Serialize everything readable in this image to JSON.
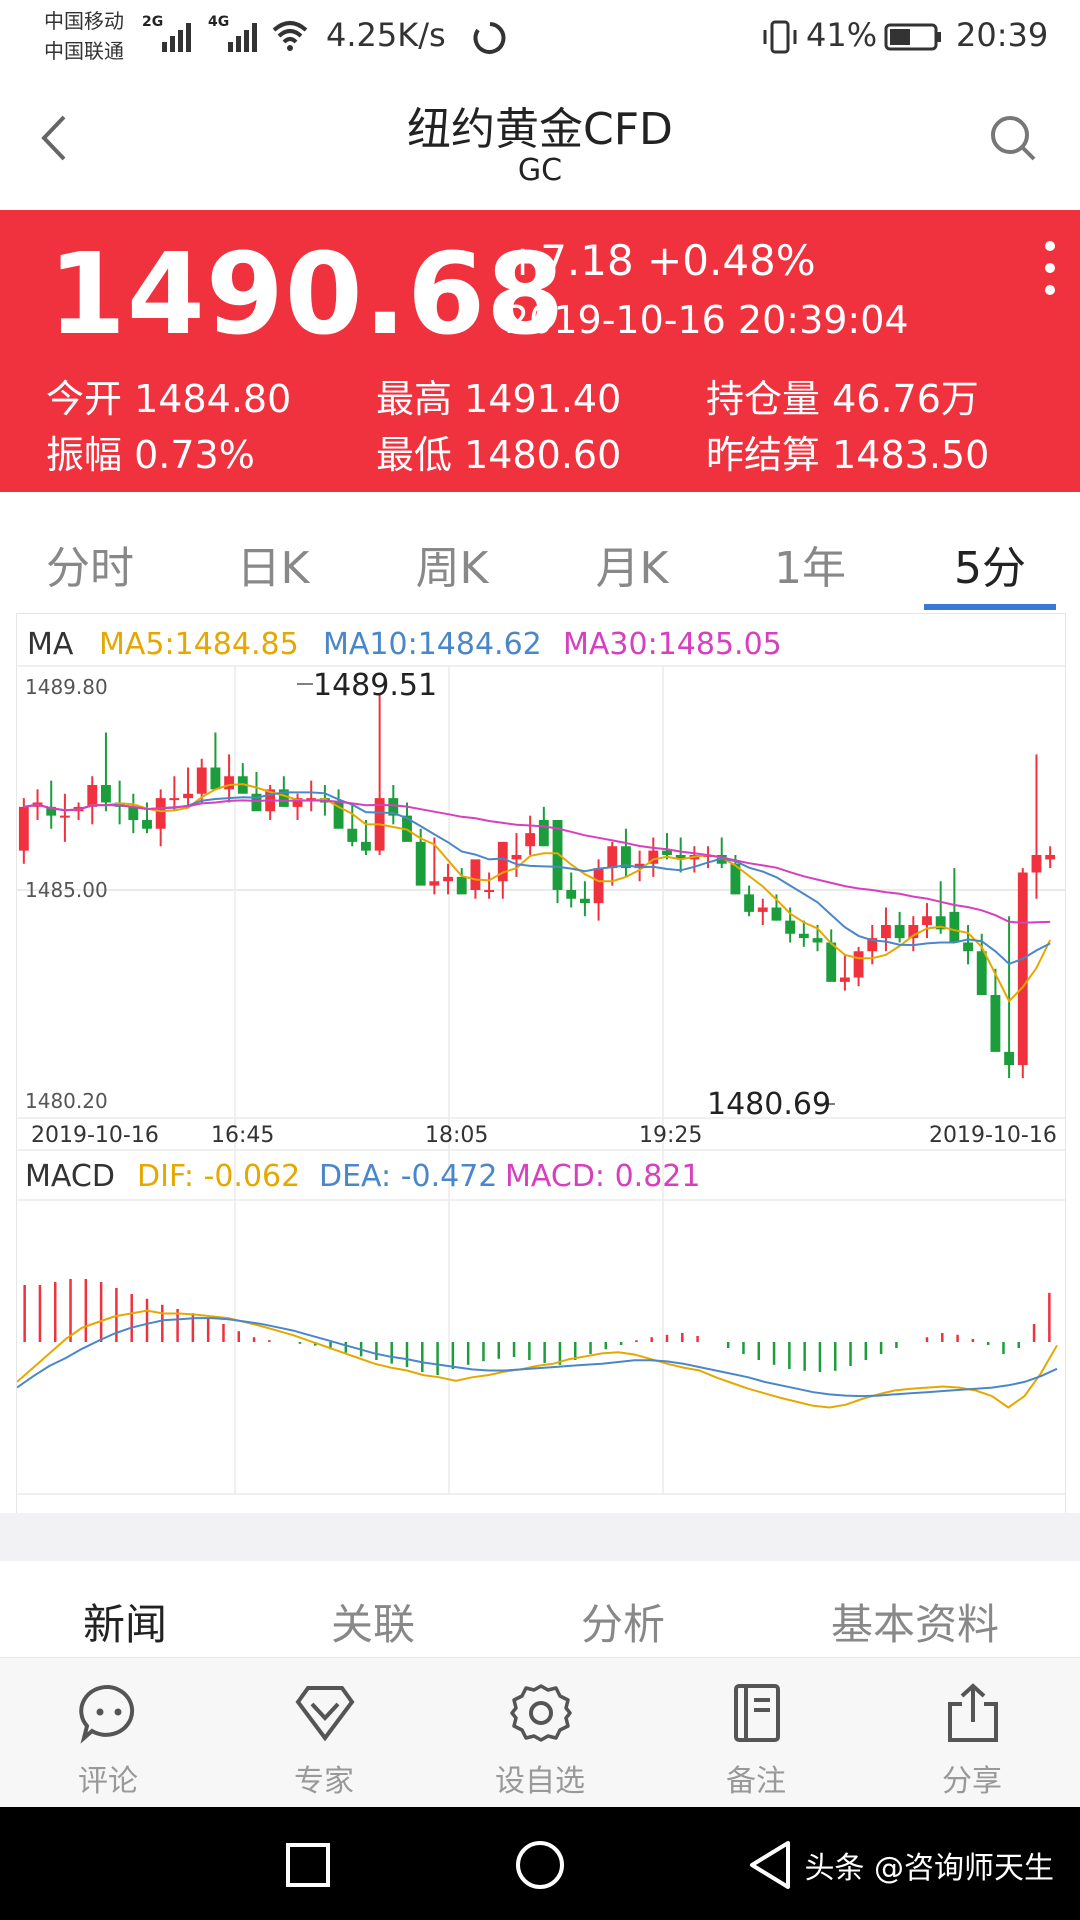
{
  "status_bar": {
    "carrier1": "中国移动",
    "carrier2": "中国联通",
    "net1": "2G",
    "net2": "4G",
    "speed": "4.25K/s",
    "battery": "41%",
    "time": "20:39"
  },
  "header": {
    "title": "纽约黄金CFD",
    "subtitle": "GC"
  },
  "quote": {
    "price": "1490.68",
    "change": "+7.18 +0.48%",
    "datetime": "2019-10-16 20:39:04",
    "stats": [
      {
        "label": "今开",
        "value": "1484.80"
      },
      {
        "label": "最高",
        "value": "1491.40"
      },
      {
        "label": "持仓量",
        "value": "46.76万"
      },
      {
        "label": "振幅",
        "value": "0.73%"
      },
      {
        "label": "最低",
        "value": "1480.60"
      },
      {
        "label": "昨结算",
        "value": "1483.50"
      }
    ]
  },
  "tabs": [
    "分时",
    "日K",
    "周K",
    "月K",
    "1年",
    "5分"
  ],
  "active_tab": "5分",
  "colors": {
    "up": "#f0313e",
    "down": "#1a9d3a",
    "ma5": "#e6a800",
    "ma10": "#4a87c9",
    "ma30": "#d83fbf",
    "accent": "#3a79d3"
  },
  "chart_data": [
    {
      "type": "candlestick",
      "legend": {
        "ma": "MA",
        "ma5": "MA5:1484.85",
        "ma10": "MA10:1484.62",
        "ma30": "MA30:1485.05"
      },
      "ylim": [
        1480.2,
        1489.8
      ],
      "y_ticks": [
        "1489.80",
        "1485.00",
        "1480.20"
      ],
      "x_ticks": [
        "2019-10-16",
        "16:45",
        "18:05",
        "19:25",
        "2019-10-16"
      ],
      "annotations": {
        "high": "1489.51",
        "low": "1480.69"
      },
      "ohlc": [
        [
          1485.9,
          1487.1,
          1485.6,
          1486.9
        ],
        [
          1486.9,
          1487.3,
          1486.6,
          1487.0
        ],
        [
          1486.9,
          1487.5,
          1486.4,
          1486.7
        ],
        [
          1486.7,
          1487.2,
          1486.1,
          1486.7
        ],
        [
          1486.8,
          1487.0,
          1486.6,
          1486.9
        ],
        [
          1486.9,
          1487.6,
          1486.5,
          1487.4
        ],
        [
          1487.4,
          1488.6,
          1486.8,
          1487.0
        ],
        [
          1487.0,
          1487.5,
          1486.5,
          1486.9
        ],
        [
          1486.9,
          1487.2,
          1486.3,
          1486.6
        ],
        [
          1486.6,
          1487.0,
          1486.3,
          1486.4
        ],
        [
          1486.4,
          1487.3,
          1486.0,
          1487.1
        ],
        [
          1487.1,
          1487.6,
          1486.8,
          1487.1
        ],
        [
          1487.1,
          1487.8,
          1486.9,
          1487.2
        ],
        [
          1487.2,
          1488.0,
          1487.0,
          1487.8
        ],
        [
          1487.8,
          1488.6,
          1487.4,
          1487.3
        ],
        [
          1487.3,
          1488.1,
          1487.0,
          1487.6
        ],
        [
          1487.6,
          1487.9,
          1487.3,
          1487.2
        ],
        [
          1487.2,
          1487.7,
          1486.9,
          1486.8
        ],
        [
          1486.8,
          1487.4,
          1486.6,
          1487.3
        ],
        [
          1487.3,
          1487.6,
          1486.9,
          1486.9
        ],
        [
          1486.9,
          1487.2,
          1486.6,
          1487.1
        ],
        [
          1487.1,
          1487.5,
          1486.8,
          1487.1
        ],
        [
          1487.1,
          1487.4,
          1486.7,
          1487.0
        ],
        [
          1487.0,
          1487.3,
          1486.5,
          1486.4
        ],
        [
          1486.4,
          1487.0,
          1486.0,
          1486.1
        ],
        [
          1486.1,
          1486.6,
          1485.8,
          1485.9
        ],
        [
          1485.9,
          1489.5,
          1485.8,
          1487.1
        ],
        [
          1487.1,
          1487.4,
          1486.5,
          1486.7
        ],
        [
          1486.7,
          1487.0,
          1486.3,
          1486.1
        ],
        [
          1486.1,
          1486.4,
          1485.6,
          1485.1
        ],
        [
          1485.1,
          1486.2,
          1484.9,
          1485.2
        ],
        [
          1485.2,
          1485.6,
          1484.9,
          1485.3
        ],
        [
          1485.3,
          1485.5,
          1485.0,
          1484.9
        ],
        [
          1485.0,
          1485.6,
          1484.8,
          1485.7
        ],
        [
          1485.0,
          1485.4,
          1484.8,
          1485.0
        ],
        [
          1485.2,
          1485.8,
          1484.8,
          1486.1
        ],
        [
          1485.7,
          1486.3,
          1485.3,
          1485.8
        ],
        [
          1486.0,
          1486.7,
          1485.8,
          1486.3
        ],
        [
          1486.6,
          1486.9,
          1486.0,
          1486.0
        ],
        [
          1486.6,
          1486.6,
          1484.7,
          1485.0
        ],
        [
          1485.0,
          1485.4,
          1484.6,
          1484.8
        ],
        [
          1484.8,
          1485.2,
          1484.4,
          1484.7
        ],
        [
          1484.7,
          1485.7,
          1484.3,
          1485.5
        ],
        [
          1485.5,
          1486.1,
          1485.1,
          1486.0
        ],
        [
          1486.0,
          1486.4,
          1485.3,
          1485.5
        ],
        [
          1485.5,
          1485.9,
          1485.2,
          1485.6
        ],
        [
          1485.6,
          1486.2,
          1485.3,
          1485.9
        ],
        [
          1485.9,
          1486.3,
          1485.7,
          1485.8
        ],
        [
          1485.8,
          1486.2,
          1485.4,
          1485.7
        ],
        [
          1485.7,
          1486.0,
          1485.4,
          1485.8
        ],
        [
          1485.8,
          1486.0,
          1485.5,
          1485.8
        ],
        [
          1485.8,
          1486.2,
          1485.5,
          1485.6
        ],
        [
          1485.6,
          1485.8,
          1484.9,
          1484.9
        ],
        [
          1484.9,
          1485.1,
          1484.4,
          1484.5
        ],
        [
          1484.5,
          1484.8,
          1484.2,
          1484.6
        ],
        [
          1484.6,
          1484.9,
          1484.3,
          1484.3
        ],
        [
          1484.3,
          1484.6,
          1483.8,
          1484.0
        ],
        [
          1484.0,
          1484.3,
          1483.7,
          1483.9
        ],
        [
          1483.9,
          1484.2,
          1483.6,
          1483.8
        ],
        [
          1483.8,
          1484.1,
          1483.4,
          1482.9
        ],
        [
          1482.9,
          1483.5,
          1482.7,
          1483.0
        ],
        [
          1483.0,
          1483.7,
          1482.8,
          1483.6
        ],
        [
          1483.6,
          1484.2,
          1483.3,
          1483.9
        ],
        [
          1483.9,
          1484.6,
          1483.6,
          1484.2
        ],
        [
          1484.2,
          1484.5,
          1483.8,
          1483.9
        ],
        [
          1483.9,
          1484.4,
          1483.6,
          1484.2
        ],
        [
          1484.2,
          1484.7,
          1483.9,
          1484.4
        ],
        [
          1484.4,
          1485.2,
          1484.0,
          1484.1
        ],
        [
          1484.5,
          1485.5,
          1483.9,
          1483.8
        ],
        [
          1483.8,
          1484.2,
          1483.3,
          1483.6
        ],
        [
          1483.6,
          1484.0,
          1482.8,
          1482.6
        ],
        [
          1482.6,
          1483.2,
          1481.6,
          1481.3
        ],
        [
          1481.3,
          1484.4,
          1480.7,
          1481.0
        ],
        [
          1481.0,
          1485.5,
          1480.7,
          1485.4
        ],
        [
          1485.4,
          1488.1,
          1484.8,
          1485.8
        ],
        [
          1485.7,
          1486.0,
          1485.5,
          1485.8
        ]
      ]
    },
    {
      "type": "macd",
      "legend": {
        "title": "MACD",
        "dif": "DIF: -0.062",
        "dea": "DEA: -0.472",
        "macd": "MACD: 0.821"
      },
      "histogram": [
        0.95,
        0.95,
        1.0,
        1.05,
        1.05,
        1.0,
        0.9,
        0.8,
        0.72,
        0.62,
        0.55,
        0.48,
        0.4,
        0.3,
        0.18,
        0.08,
        0.03,
        0.0,
        -0.03,
        -0.06,
        -0.12,
        -0.18,
        -0.24,
        -0.3,
        -0.36,
        -0.42,
        -0.5,
        -0.55,
        -0.45,
        -0.38,
        -0.32,
        -0.28,
        -0.25,
        -0.3,
        -0.35,
        -0.38,
        -0.3,
        -0.2,
        -0.12,
        -0.05,
        0.03,
        0.08,
        0.12,
        0.15,
        0.1,
        0.0,
        -0.1,
        -0.2,
        -0.3,
        -0.38,
        -0.45,
        -0.48,
        -0.5,
        -0.48,
        -0.4,
        -0.3,
        -0.2,
        -0.1,
        0.0,
        0.08,
        0.15,
        0.12,
        0.05,
        -0.05,
        -0.2,
        -0.1,
        0.3,
        0.82
      ],
      "dif": [
        -0.7,
        -0.45,
        -0.2,
        0.05,
        0.25,
        0.35,
        0.45,
        0.5,
        0.55,
        0.5,
        0.5,
        0.48,
        0.45,
        0.42,
        0.35,
        0.28,
        0.2,
        0.12,
        0.02,
        -0.08,
        -0.18,
        -0.28,
        -0.38,
        -0.45,
        -0.5,
        -0.58,
        -0.62,
        -0.68,
        -0.62,
        -0.58,
        -0.52,
        -0.48,
        -0.42,
        -0.38,
        -0.3,
        -0.25,
        -0.2,
        -0.18,
        -0.22,
        -0.3,
        -0.38,
        -0.45,
        -0.5,
        -0.62,
        -0.72,
        -0.82,
        -0.9,
        -0.98,
        -1.05,
        -1.12,
        -1.15,
        -1.1,
        -1.0,
        -0.92,
        -0.85,
        -0.82,
        -0.8,
        -0.78,
        -0.8,
        -0.85,
        -0.95,
        -1.15,
        -0.95,
        -0.55,
        -0.06
      ],
      "dea": [
        -0.8,
        -0.6,
        -0.42,
        -0.28,
        -0.12,
        0.02,
        0.15,
        0.25,
        0.32,
        0.38,
        0.4,
        0.42,
        0.42,
        0.4,
        0.36,
        0.32,
        0.26,
        0.2,
        0.12,
        0.04,
        -0.04,
        -0.12,
        -0.2,
        -0.26,
        -0.3,
        -0.36,
        -0.4,
        -0.44,
        -0.48,
        -0.5,
        -0.5,
        -0.48,
        -0.46,
        -0.44,
        -0.42,
        -0.4,
        -0.38,
        -0.35,
        -0.32,
        -0.32,
        -0.34,
        -0.38,
        -0.44,
        -0.5,
        -0.56,
        -0.62,
        -0.7,
        -0.76,
        -0.82,
        -0.88,
        -0.92,
        -0.94,
        -0.95,
        -0.94,
        -0.92,
        -0.9,
        -0.88,
        -0.86,
        -0.84,
        -0.82,
        -0.8,
        -0.76,
        -0.7,
        -0.6,
        -0.47
      ]
    }
  ],
  "info_tabs": [
    "新闻",
    "关联",
    "分析",
    "基本资料"
  ],
  "toolbar": [
    {
      "label": "评论",
      "icon": "comment-icon"
    },
    {
      "label": "专家",
      "icon": "expert-icon"
    },
    {
      "label": "设自选",
      "icon": "settings-icon"
    },
    {
      "label": "备注",
      "icon": "note-icon"
    },
    {
      "label": "分享",
      "icon": "share-icon"
    }
  ],
  "watermark": "头条 @咨询师天生"
}
